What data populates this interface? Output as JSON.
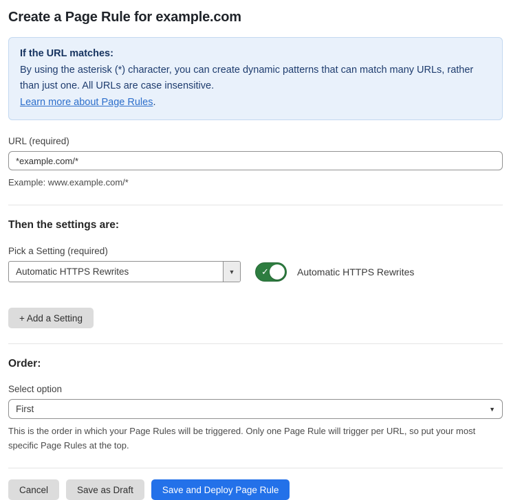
{
  "page": {
    "title": "Create a Page Rule for example.com"
  },
  "info_box": {
    "heading": "If the URL matches:",
    "body": "By using the asterisk (*) character, you can create dynamic patterns that can match many URLs, rather than just one. All URLs are case insensitive.",
    "link_label": "Learn more about Page Rules",
    "link_suffix": "."
  },
  "url_field": {
    "label": "URL (required)",
    "value": "*example.com/*",
    "helper": "Example: www.example.com/*"
  },
  "settings_section": {
    "heading": "Then the settings are:",
    "picker_label": "Pick a Setting (required)",
    "picker_value": "Automatic HTTPS Rewrites",
    "picker_arrow_icon": "▼",
    "toggle_state": "on",
    "toggle_check_icon": "✓",
    "toggle_label": "Automatic HTTPS Rewrites",
    "add_button_label": "+ Add a Setting"
  },
  "order_section": {
    "heading": "Order:",
    "select_label": "Select option",
    "select_value": "First",
    "select_arrow_icon": "▼",
    "helper": "This is the order in which your Page Rules will be triggered. Only one Page Rule will trigger per URL, so put your most specific Page Rules at the top."
  },
  "footer": {
    "cancel_label": "Cancel",
    "save_draft_label": "Save as Draft",
    "save_deploy_label": "Save and Deploy Page Rule"
  },
  "colors": {
    "info_box_bg": "#e9f1fb",
    "info_box_border": "#c3d8f0",
    "info_text": "#1e3c6e",
    "link_blue": "#2c6ecb",
    "toggle_green": "#2e7d40",
    "primary_button_blue": "#2371e9",
    "gray_button_bg": "#dcdcdc"
  }
}
